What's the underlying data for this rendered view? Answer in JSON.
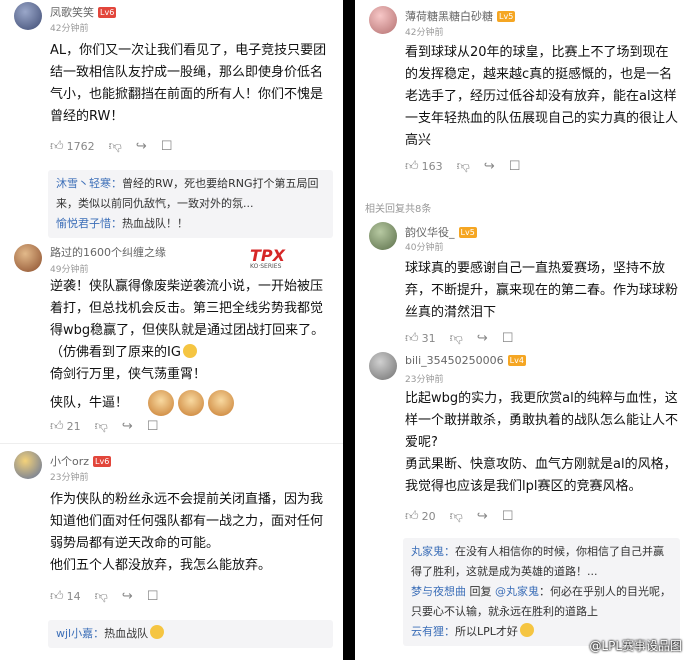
{
  "left": {
    "c1": {
      "name": "凤歌笑笑",
      "level": "Lv6",
      "time": "42分钟前",
      "text": "AL，你们又一次让我们看见了，电子竞技只要团结一致相信队友拧成一股绳，那么即使身价低名气小，也能掀翻挡在前面的所有人！你们不愧是曾经的RW！",
      "likes": "1762",
      "replies": [
        {
          "user": "沐雪丶轻寒：",
          "text": "曾经的RW，死也要给RNG打个第五局回来，类似以前同仇敌忾，一致对外的氛..."
        },
        {
          "user": "愉悦君子惜：",
          "text": "热血战队！！"
        }
      ]
    },
    "c2": {
      "name": "路过的1600个纠缠之缘",
      "time": "49分钟前",
      "logo": "TPX",
      "logo_sub": "KO·SERIES",
      "p1": "逆袭！侠队赢得像废柴逆袭流小说，一开始被压着打，但总找机会反击。第三把全线劣势我都觉得wbg稳赢了，但侠队就是通过团战打回来了。",
      "p2": "（仿佛看到了原来的IG",
      "p3": "倚剑行万里，侠气荡重霄！",
      "p4": "侠队，牛逼！",
      "likes": "21"
    },
    "c3": {
      "name": "小个orz",
      "level": "Lv6",
      "time": "23分钟前",
      "p1": "作为侠队的粉丝永远不会提前关闭直播，因为我知道他们面对任何强队都有一战之力，面对任何弱势局都有逆天改命的可能。",
      "p2": "他们五个人都没放弃，我怎么能放弃。",
      "likes": "14",
      "reply": {
        "user": "wjl小嘉：",
        "text": "热血战队"
      }
    }
  },
  "right": {
    "c1": {
      "name": "薄荷糖黑糖白砂糖",
      "level": "Lv5",
      "time": "42分钟前",
      "text": "看到球球从20年的球皇，比赛上不了场到现在的发挥稳定，越来越c真的挺感慨的，也是一名老选手了，经历过低谷却没有放弃，能在al这样一支年轻热血的队伍展现自己的实力真的很让人高兴",
      "likes": "163"
    },
    "section": "相关回复共8条",
    "c2": {
      "name": "韵仪华役_",
      "level": "Lv5",
      "time": "40分钟前",
      "text": "球球真的要感谢自己一直热爱赛场，坚持不放弃，不断提升，赢来现在的第二春。作为球球粉丝真的潸然泪下",
      "likes": "31"
    },
    "c3": {
      "name": "bili_35450250006",
      "level": "Lv4",
      "time": "23分钟前",
      "p1": "比起wbg的实力，我更欣赏al的纯粹与血性，这样一个敢拼敢杀，勇敢执着的战队怎么能让人不爱呢?",
      "p2": "勇武果断、快意攻防、血气方刚就是al的风格，我觉得也应该是我们lpl赛区的竞赛风格。",
      "likes": "20",
      "replies": [
        {
          "user": "丸家鬼：",
          "text": "在没有人相信你的时候，你相信了自己并赢得了胜利，这就是成为英雄的道路！..."
        },
        {
          "user": "梦与夜想曲",
          "mid": " 回复 ",
          "to": "@丸家鬼",
          "text": "：何必在乎别人的目光呢，只要心不认输，就永远在胜利的道路上"
        },
        {
          "user": "云有狸：",
          "text": "所以LPL才好"
        }
      ]
    }
  },
  "watermark": "@LPL赛事设品图",
  "icons": [
    "thumb-up-icon",
    "thumb-down-icon",
    "share-icon",
    "comment-icon"
  ]
}
